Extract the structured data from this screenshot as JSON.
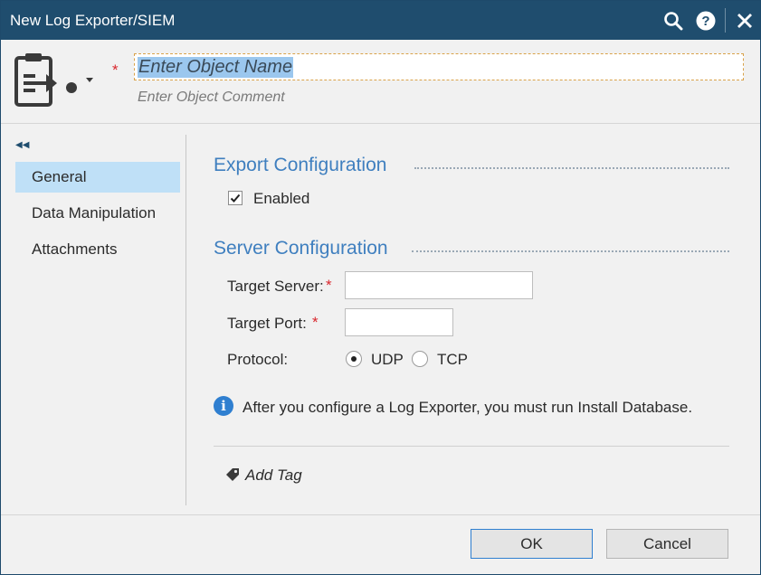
{
  "window": {
    "title": "New Log Exporter/SIEM"
  },
  "titlebar_icons": [
    "search-icon",
    "help-icon",
    "close-icon"
  ],
  "header": {
    "name_placeholder": "Enter Object Name",
    "comment_placeholder": "Enter Object Comment",
    "required_mark": "*"
  },
  "sidebar": {
    "items": [
      {
        "label": "General",
        "active": true
      },
      {
        "label": "Data Manipulation",
        "active": false
      },
      {
        "label": "Attachments",
        "active": false
      }
    ]
  },
  "export_config": {
    "title": "Export Configuration",
    "enabled_label": "Enabled",
    "enabled": true
  },
  "server_config": {
    "title": "Server Configuration",
    "target_server_label": "Target Server:",
    "target_server_value": "",
    "target_port_label": "Target Port:",
    "target_port_value": "",
    "required_mark": "*",
    "protocol_label": "Protocol:",
    "protocol_options": [
      "UDP",
      "TCP"
    ],
    "protocol_selected": "UDP"
  },
  "info": {
    "message": "After you configure a Log Exporter, you must run Install Database."
  },
  "tags": {
    "add_label": "Add Tag"
  },
  "footer": {
    "ok_label": "OK",
    "cancel_label": "Cancel"
  },
  "colors": {
    "titlebar": "#1f4d6e",
    "accent": "#3f7fbf",
    "active_nav": "#bfe0f7",
    "required": "#d9272e"
  }
}
